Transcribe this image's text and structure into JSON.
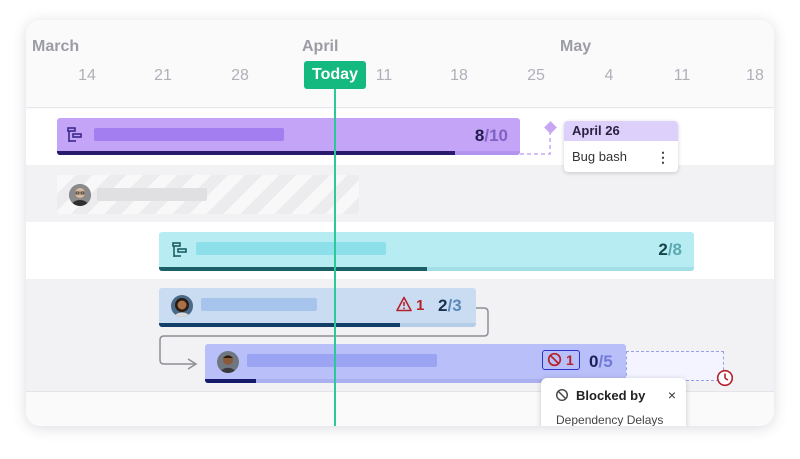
{
  "timeline": {
    "months": [
      "March",
      "April",
      "May"
    ],
    "days": [
      "14",
      "21",
      "28",
      "4",
      "11",
      "18",
      "25",
      "4",
      "11",
      "18"
    ],
    "today_label": "Today"
  },
  "rows": [
    {
      "type": "epic",
      "done": "8",
      "total": "/10",
      "progress_pct": 0.86,
      "color": "#c4a4f7",
      "bar_dark": "#2a1a6b",
      "icon": "roadmap-icon"
    },
    {
      "type": "placeholder",
      "avatar": "avatar-man-glasses"
    },
    {
      "type": "epic",
      "done": "2",
      "total": "/8",
      "progress_pct": 0.5,
      "color": "#b8ecf3",
      "bar_dark": "#1c5f66",
      "icon": "roadmap-icon"
    },
    {
      "type": "task",
      "warning_count": "1",
      "done": "2",
      "total": "/3",
      "progress_pct": 0.76,
      "color": "#c9dcf2",
      "bar_dark": "#143e6a",
      "avatar": "avatar-woman"
    },
    {
      "type": "task",
      "blocked_count": "1",
      "done": "0",
      "total": "/5",
      "progress_pct": 0.12,
      "color": "#b9bff8",
      "bar_dark": "#151a6a",
      "avatar": "avatar-man"
    }
  ],
  "milestone": {
    "date": "April 26",
    "title": "Bug bash"
  },
  "blocked_popup": {
    "title": "Blocked by",
    "detail": "Dependency Delays",
    "close": "×"
  },
  "colors": {
    "today": "#14b97f",
    "warning": "#b4232c",
    "blocked": "#b4232c"
  }
}
